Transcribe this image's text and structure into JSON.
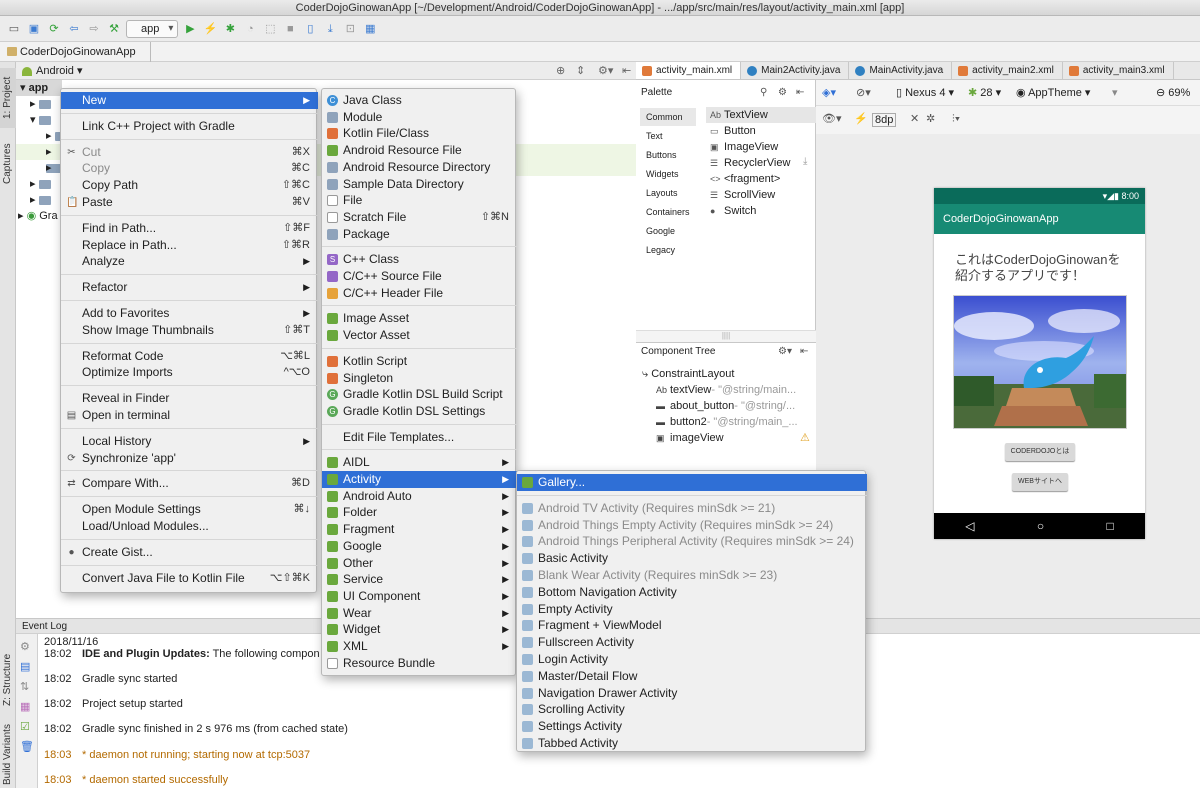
{
  "window": {
    "title": "CoderDojoGinowanApp [~/Development/Android/CoderDojoGinowanApp] - .../app/src/main/res/layout/activity_main.xml [app]"
  },
  "toolbar": {
    "run_config": "app"
  },
  "navbar": {
    "crumb": "CoderDojoGinowanApp"
  },
  "left_rail": {
    "project": "1: Project",
    "captures": "Captures",
    "structure": "Z: Structure",
    "build_variants": "Build Variants"
  },
  "project_panel": {
    "view": "Android",
    "root": "app",
    "gradle": "Gra"
  },
  "editor_tabs": [
    "activity_main.xml",
    "Main2Activity.java",
    "MainActivity.java",
    "activity_main2.xml",
    "activity_main3.xml"
  ],
  "palette": {
    "title": "Palette",
    "categories": [
      "Common",
      "Text",
      "Buttons",
      "Widgets",
      "Layouts",
      "Containers",
      "Google",
      "Legacy"
    ],
    "items": [
      {
        "icon": "Ab",
        "label": "TextView"
      },
      {
        "icon": "▭",
        "label": "Button"
      },
      {
        "icon": "▣",
        "label": "ImageView"
      },
      {
        "icon": "☰",
        "label": "RecyclerView"
      },
      {
        "icon": "<>",
        "label": "<fragment>"
      },
      {
        "icon": "☰",
        "label": "ScrollView"
      },
      {
        "icon": "●",
        "label": "Switch"
      }
    ]
  },
  "design_toolbar": {
    "device": "Nexus 4",
    "api": "28",
    "theme": "AppTheme",
    "zoom": "69%",
    "margin": "8dp"
  },
  "component_tree": {
    "title": "Component Tree",
    "root": "ConstraintLayout",
    "items": [
      {
        "name": "textView",
        "detail": "- \"@string/main...",
        "icon": "Ab"
      },
      {
        "name": "about_button",
        "detail": "- \"@string/...",
        "icon": "▬"
      },
      {
        "name": "button2",
        "detail": "- \"@string/main_...",
        "icon": "▬"
      },
      {
        "name": "imageView",
        "detail": "",
        "icon": "▣"
      }
    ]
  },
  "phone": {
    "time": "8:00",
    "app_name": "CoderDojoGinowanApp",
    "text": "これはCoderDojoGinowanを紹介するアプリです！",
    "button1": "CODERDOJOとは",
    "button2": "WEBサイトへ"
  },
  "event_log": {
    "title": "Event Log",
    "date": "2018/11/16",
    "rows": [
      {
        "time": "18:02",
        "bold": "IDE and Plugin Updates:",
        "text": " The following compon"
      },
      {
        "time": "18:02",
        "bold": "",
        "text": "Gradle sync started"
      },
      {
        "time": "18:02",
        "bold": "",
        "text": "Project setup started"
      },
      {
        "time": "18:02",
        "bold": "",
        "text": "Gradle sync finished in 2 s 976 ms (from cached state)"
      },
      {
        "time": "18:03",
        "bold": "",
        "text": "* daemon not running; starting now at tcp:5037"
      },
      {
        "time": "18:03",
        "bold": "",
        "text": "* daemon started successfully"
      }
    ]
  },
  "menu1": [
    {
      "label": "New",
      "arrow": true,
      "sel": true
    },
    {
      "sep": true
    },
    {
      "label": "Link C++ Project with Gradle"
    },
    {
      "sep": true
    },
    {
      "label": "Cut",
      "sc": "⌘X",
      "dis": true,
      "icon": "✂"
    },
    {
      "label": "Copy",
      "sc": "⌘C",
      "dis": true
    },
    {
      "label": "Copy Path",
      "sc": "⇧⌘C"
    },
    {
      "label": "Paste",
      "sc": "⌘V",
      "icon": "📋"
    },
    {
      "sep": true
    },
    {
      "label": "Find in Path...",
      "sc": "⇧⌘F"
    },
    {
      "label": "Replace in Path...",
      "sc": "⇧⌘R"
    },
    {
      "label": "Analyze",
      "arrow": true
    },
    {
      "sep": true
    },
    {
      "label": "Refactor",
      "arrow": true
    },
    {
      "sep": true
    },
    {
      "label": "Add to Favorites",
      "arrow": true
    },
    {
      "label": "Show Image Thumbnails",
      "sc": "⇧⌘T"
    },
    {
      "sep": true
    },
    {
      "label": "Reformat Code",
      "sc": "⌥⌘L"
    },
    {
      "label": "Optimize Imports",
      "sc": "^⌥O"
    },
    {
      "sep": true
    },
    {
      "label": "Reveal in Finder"
    },
    {
      "label": "Open in terminal",
      "icon": "▤"
    },
    {
      "sep": true
    },
    {
      "label": "Local History",
      "arrow": true
    },
    {
      "label": "Synchronize 'app'",
      "icon": "⟳"
    },
    {
      "sep": true
    },
    {
      "label": "Compare With...",
      "sc": "⌘D",
      "icon": "⇄"
    },
    {
      "sep": true
    },
    {
      "label": "Open Module Settings",
      "sc": "⌘↓"
    },
    {
      "label": "Load/Unload Modules..."
    },
    {
      "sep": true
    },
    {
      "label": "Create Gist...",
      "icon": "●"
    },
    {
      "sep": true
    },
    {
      "label": "Convert Java File to Kotlin File",
      "sc": "⌥⇧⌘K"
    }
  ],
  "menu2": [
    {
      "label": "Java Class",
      "ic": "ic-c",
      "icon": "C"
    },
    {
      "label": "Module",
      "ic": "ic-folder"
    },
    {
      "label": "Kotlin File/Class",
      "ic": "ic-kt"
    },
    {
      "label": "Android Resource File",
      "ic": "ic-droid"
    },
    {
      "label": "Android Resource Directory",
      "ic": "ic-folder"
    },
    {
      "label": "Sample Data Directory",
      "ic": "ic-folder"
    },
    {
      "label": "File",
      "ic": "ic-file"
    },
    {
      "label": "Scratch File",
      "sc": "⇧⌘N",
      "ic": "ic-file"
    },
    {
      "label": "Package",
      "ic": "ic-folder"
    },
    {
      "sep": true
    },
    {
      "label": "C++ Class",
      "ic": "ic-s",
      "icon": "S"
    },
    {
      "label": "C/C++ Source File",
      "ic": "ic-s"
    },
    {
      "label": "C/C++ Header File",
      "ic": "ic-h"
    },
    {
      "sep": true
    },
    {
      "label": "Image Asset",
      "ic": "ic-droid"
    },
    {
      "label": "Vector Asset",
      "ic": "ic-droid"
    },
    {
      "sep": true
    },
    {
      "label": "Kotlin Script",
      "ic": "ic-kt"
    },
    {
      "label": "Singleton",
      "ic": "ic-kt"
    },
    {
      "label": "Gradle Kotlin DSL Build Script",
      "ic": "ic-g",
      "icon": "G"
    },
    {
      "label": "Gradle Kotlin DSL Settings",
      "ic": "ic-g",
      "icon": "G"
    },
    {
      "sep": true
    },
    {
      "label": "Edit File Templates..."
    },
    {
      "sep": true
    },
    {
      "label": "AIDL",
      "arrow": true,
      "ic": "ic-droid"
    },
    {
      "label": "Activity",
      "arrow": true,
      "sel": true,
      "ic": "ic-droid"
    },
    {
      "label": "Android Auto",
      "arrow": true,
      "ic": "ic-droid"
    },
    {
      "label": "Folder",
      "arrow": true,
      "ic": "ic-droid"
    },
    {
      "label": "Fragment",
      "arrow": true,
      "ic": "ic-droid"
    },
    {
      "label": "Google",
      "arrow": true,
      "ic": "ic-droid"
    },
    {
      "label": "Other",
      "arrow": true,
      "ic": "ic-droid"
    },
    {
      "label": "Service",
      "arrow": true,
      "ic": "ic-droid"
    },
    {
      "label": "UI Component",
      "arrow": true,
      "ic": "ic-droid"
    },
    {
      "label": "Wear",
      "arrow": true,
      "ic": "ic-droid"
    },
    {
      "label": "Widget",
      "arrow": true,
      "ic": "ic-droid"
    },
    {
      "label": "XML",
      "arrow": true,
      "ic": "ic-droid"
    },
    {
      "label": "Resource Bundle",
      "ic": "ic-file"
    }
  ],
  "menu3": [
    {
      "label": "Gallery...",
      "sel": true,
      "ic": "ic-droid"
    },
    {
      "sep": true
    },
    {
      "label": "Android TV Activity (Requires minSdk >= 21)",
      "dis": true,
      "ic": "ic-act"
    },
    {
      "label": "Android Things Empty Activity (Requires minSdk >= 24)",
      "dis": true,
      "ic": "ic-act"
    },
    {
      "label": "Android Things Peripheral Activity (Requires minSdk >= 24)",
      "dis": true,
      "ic": "ic-act"
    },
    {
      "label": "Basic Activity",
      "ic": "ic-act"
    },
    {
      "label": "Blank Wear Activity (Requires minSdk >= 23)",
      "dis": true,
      "ic": "ic-act"
    },
    {
      "label": "Bottom Navigation Activity",
      "ic": "ic-act"
    },
    {
      "label": "Empty Activity",
      "ic": "ic-act"
    },
    {
      "label": "Fragment + ViewModel",
      "ic": "ic-act"
    },
    {
      "label": "Fullscreen Activity",
      "ic": "ic-act"
    },
    {
      "label": "Login Activity",
      "ic": "ic-act"
    },
    {
      "label": "Master/Detail Flow",
      "ic": "ic-act"
    },
    {
      "label": "Navigation Drawer Activity",
      "ic": "ic-act"
    },
    {
      "label": "Scrolling Activity",
      "ic": "ic-act"
    },
    {
      "label": "Settings Activity",
      "ic": "ic-act"
    },
    {
      "label": "Tabbed Activity",
      "ic": "ic-act"
    }
  ]
}
